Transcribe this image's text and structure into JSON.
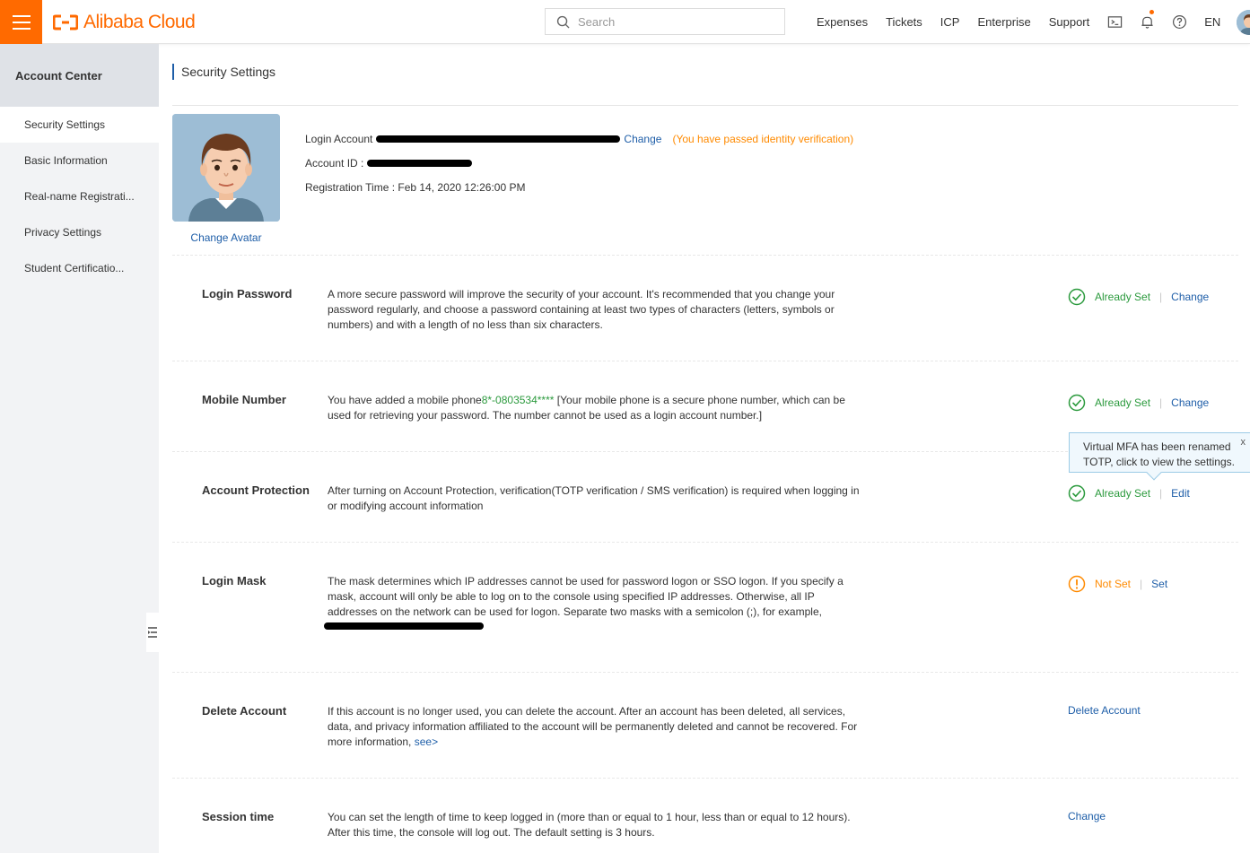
{
  "brand": {
    "name": "Alibaba Cloud",
    "color": "#ff6a00",
    "link_color": "#1e5ea8",
    "success_color": "#2b9a3d",
    "warning_color": "#ff8a00"
  },
  "header": {
    "search_placeholder": "Search",
    "nav": [
      "Expenses",
      "Tickets",
      "ICP",
      "Enterprise",
      "Support"
    ],
    "icons": [
      "terminal-icon",
      "bell-icon",
      "help-icon"
    ],
    "language": "EN"
  },
  "sidebar": {
    "title": "Account Center",
    "items": [
      {
        "label": "Security Settings",
        "active": true
      },
      {
        "label": "Basic Information"
      },
      {
        "label": "Real-name Registrati..."
      },
      {
        "label": "Privacy Settings"
      },
      {
        "label": "Student Certificatio..."
      }
    ]
  },
  "page": {
    "title": "Security Settings",
    "change_avatar": "Change Avatar",
    "login_account_label": "Login Account",
    "login_account_change": "Change",
    "identity_status": "(You have passed identity verification)",
    "account_id_label": "Account ID :",
    "registration_time": "Registration Time : Feb 14, 2020 12:26:00 PM"
  },
  "rows": {
    "login_password": {
      "label": "Login Password",
      "desc": "A more secure password will improve the security of your account. It's recommended that you change your password regularly, and choose a password containing at least two types of characters (letters, symbols or numbers) and with a length of no less than six characters.",
      "status": "Already Set",
      "action": "Change"
    },
    "mobile_number": {
      "label": "Mobile Number",
      "desc_prefix": "You have added a mobile phone",
      "phone": "8*-0803534****",
      "desc_suffix": " [Your mobile phone is a secure phone number, which can be used for retrieving your password. The number cannot be used as a login account number.]",
      "status": "Already Set",
      "action": "Change"
    },
    "account_protection": {
      "label": "Account Protection",
      "desc": "After turning on Account Protection, verification(TOTP verification / SMS verification) is required when logging in or modifying account information",
      "status": "Already Set",
      "action": "Edit",
      "tooltip": "Virtual MFA has been renamed TOTP, click to view the settings.",
      "tooltip_close": "x"
    },
    "login_mask": {
      "label": "Login Mask",
      "desc": "The mask determines which IP addresses cannot be used for password logon or SSO logon. If you specify a mask, account will only be able to log on to the console using specified IP addresses. Otherwise, all IP addresses on the network can be used for logon. Separate two masks with a semicolon (;), for example,",
      "status": "Not Set",
      "action": "Set"
    },
    "delete_account": {
      "label": "Delete Account",
      "desc": "If this account is no longer used, you can delete the account. After an account has been deleted, all services, data, and privacy information affiliated to the account will be permanently deleted and cannot be recovered. For more information,",
      "see_link": "see>",
      "action": "Delete Account"
    },
    "session_time": {
      "label": "Session time",
      "desc": "You can set the length of time to keep logged in (more than or equal to 1 hour, less than or equal to 12 hours). After this time, the console will log out. The default setting is 3 hours.",
      "action": "Change"
    }
  }
}
